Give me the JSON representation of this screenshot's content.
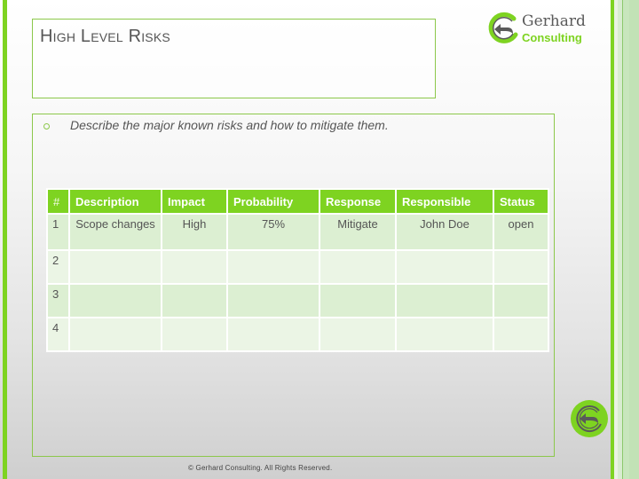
{
  "slide": {
    "title": "High Level Risks",
    "bullet": "Describe the major known risks and how to mitigate them.",
    "footer": "© Gerhard Consulting. All Rights Reserved."
  },
  "logo": {
    "name_line1": "Gerhard",
    "name_line2": "Consulting",
    "icon": "gerhard-logo-icon"
  },
  "colors": {
    "accent": "#7ed321",
    "row_dark": "#dcefd2",
    "row_light": "#ebf5e5",
    "text": "#555555"
  },
  "table": {
    "headers": [
      "#",
      "Description",
      "Impact",
      "Probability",
      "Response",
      "Responsible",
      "Status"
    ],
    "rows": [
      [
        "1",
        "Scope changes",
        "High",
        "75%",
        "Mitigate",
        "John Doe",
        "open"
      ],
      [
        "2",
        "",
        "",
        "",
        "",
        "",
        ""
      ],
      [
        "3",
        "",
        "",
        "",
        "",
        "",
        ""
      ],
      [
        "4",
        "",
        "",
        "",
        "",
        "",
        ""
      ]
    ]
  },
  "nav": {
    "icon": "back-navigation-icon"
  }
}
